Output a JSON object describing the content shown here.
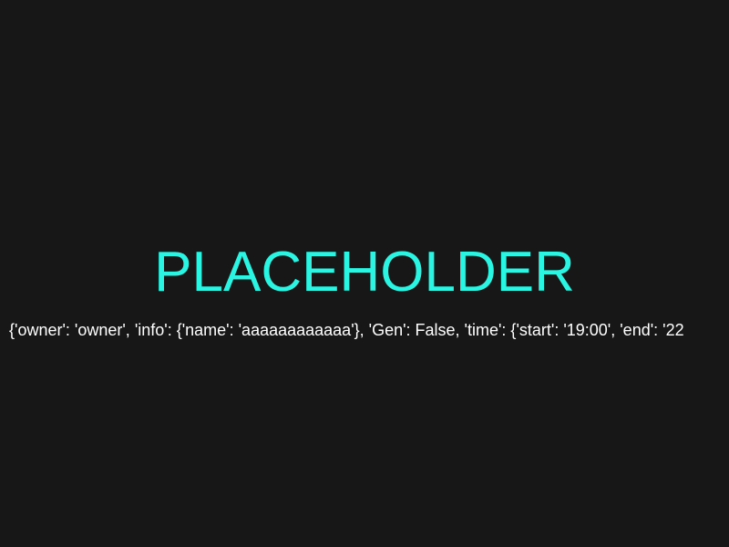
{
  "screen": {
    "title": "PLACEHOLDER",
    "data_text": "{'owner': 'owner', 'info': {'name': 'aaaaaaaaaaaa'}, 'Gen': False, 'time': {'start': '19:00', 'end': '22"
  },
  "colors": {
    "background": "#171717",
    "title": "#2af5e3",
    "text": "#ffffff"
  }
}
